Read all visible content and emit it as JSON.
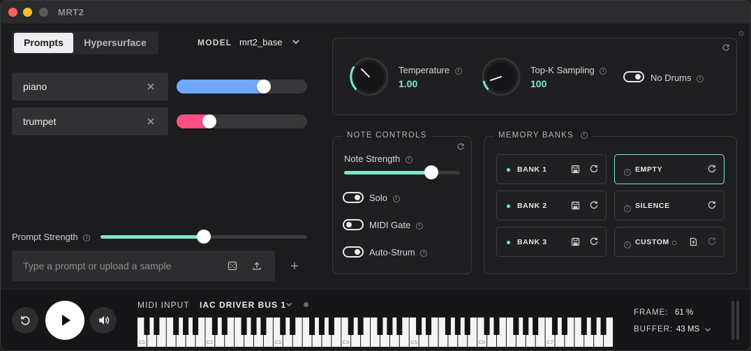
{
  "window": {
    "title": "MRT2"
  },
  "tabs": [
    {
      "label": "Prompts",
      "active": true
    },
    {
      "label": "Hypersurface",
      "active": false
    }
  ],
  "model": {
    "label": "MODEL",
    "value": "mrt2_base"
  },
  "prompts": [
    {
      "text": "piano",
      "weight": 0.67,
      "color": "#6ea8ff"
    },
    {
      "text": "trumpet",
      "weight": 0.25,
      "color": "#ff4f82"
    }
  ],
  "prompt_strength": {
    "label": "Prompt Strength",
    "value": 0.5
  },
  "add_prompt": {
    "placeholder": "Type a prompt or upload a sample"
  },
  "controls": {
    "temperature": {
      "label": "Temperature",
      "value": "1.00"
    },
    "top_k": {
      "label": "Top-K Sampling",
      "value": "100"
    },
    "no_drums": {
      "label": "No Drums",
      "on": true
    }
  },
  "note_controls": {
    "title": "NOTE CONTROLS",
    "note_strength": {
      "label": "Note Strength",
      "value": 0.75
    },
    "solo": {
      "label": "Solo",
      "on": true
    },
    "midi_gate": {
      "label": "MIDI Gate",
      "on": false
    },
    "auto_strum": {
      "label": "Auto-Strum",
      "on": true
    }
  },
  "memory_banks": {
    "title": "MEMORY BANKS",
    "left": [
      {
        "name": "BANK 1"
      },
      {
        "name": "BANK 2"
      },
      {
        "name": "BANK 3"
      }
    ],
    "right": [
      {
        "name": "EMPTY",
        "highlighted": true
      },
      {
        "name": "SILENCE"
      },
      {
        "name": "CUSTOM"
      }
    ]
  },
  "midi": {
    "label": "MIDI INPUT",
    "value": "IAC DRIVER BUS 1"
  },
  "keyboard": {
    "octave_labels": [
      "C1",
      "C2",
      "C3",
      "C4",
      "C5",
      "C6",
      "C7"
    ]
  },
  "stats": {
    "frame": {
      "label": "FRAME:",
      "value": "61 %"
    },
    "buffer": {
      "label": "BUFFER:",
      "value": "43 MS"
    }
  },
  "colors": {
    "accent": "#7ee8cf",
    "piano": "#6ea8ff",
    "trumpet": "#ff4f82"
  }
}
